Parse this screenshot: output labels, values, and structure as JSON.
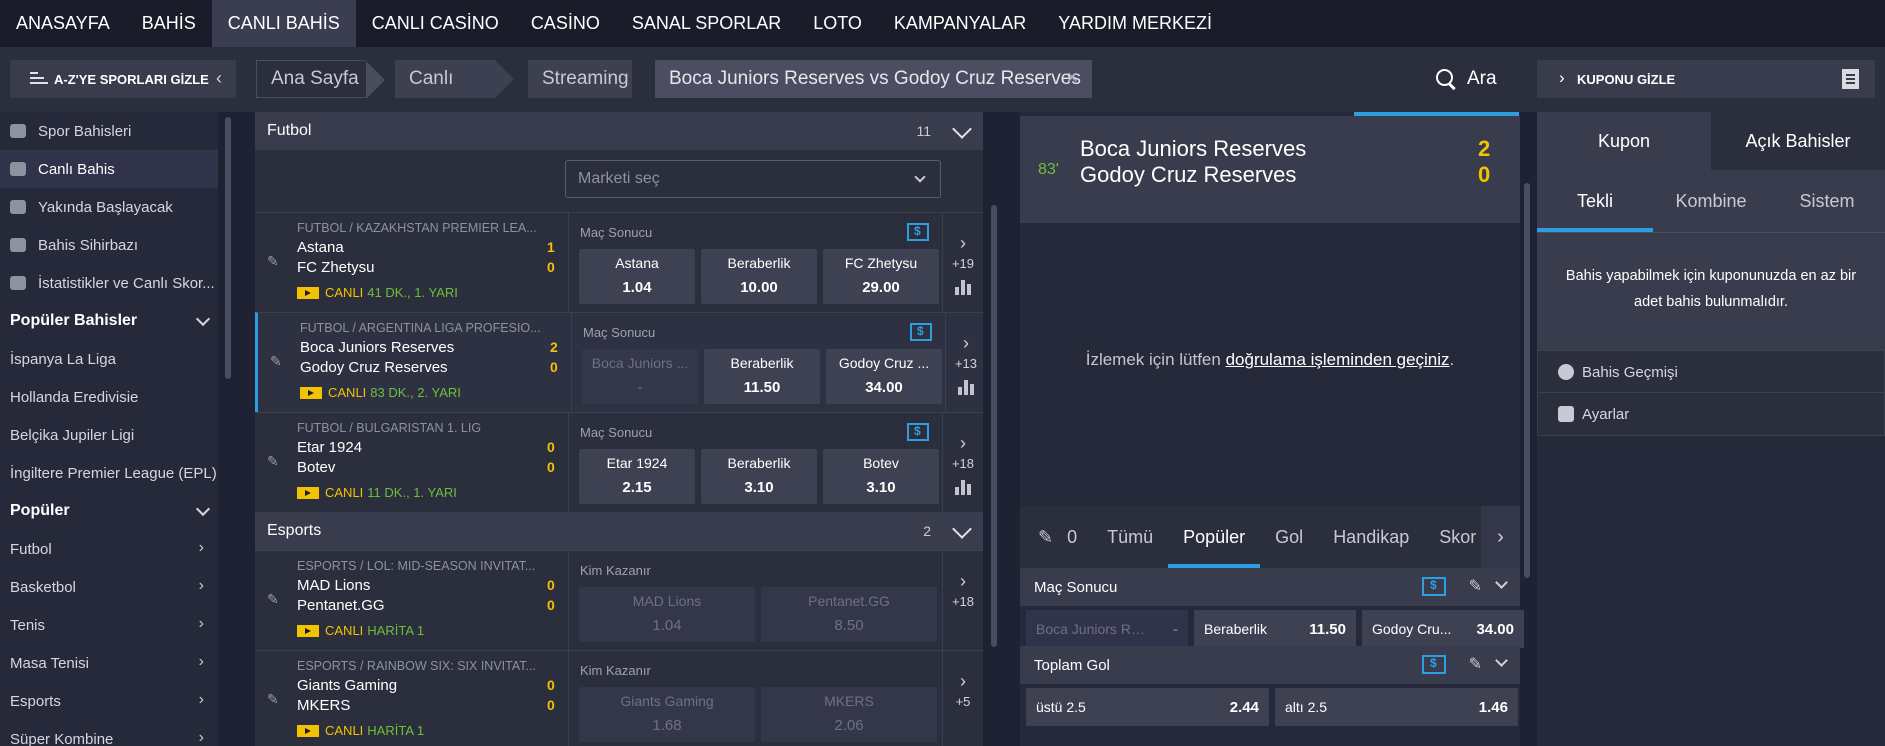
{
  "topnav": [
    "ANASAYFA",
    "BAHİS",
    "CANLI BAHİS",
    "CANLI CASİNO",
    "CASİNO",
    "SANAL SPORLAR",
    "LOTO",
    "KAMPANYALAR",
    "YARDIM MERKEZİ"
  ],
  "breadcrumbs": {
    "hide_sports": "A-Z'YE SPORLARI GİZLE",
    "home": "Ana Sayfa",
    "live": "Canlı",
    "streaming": "Streaming",
    "match": "Boca Juniors Reserves vs Godoy Cruz Reserves",
    "search": "Ara",
    "hide_coupon": "KUPONU GİZLE"
  },
  "sidebar": [
    {
      "label": "Spor Bahisleri",
      "type": "icon"
    },
    {
      "label": "Canlı Bahis",
      "type": "icon",
      "active": true
    },
    {
      "label": "Yakında Başlayacak",
      "type": "icon"
    },
    {
      "label": "Bahis Sihirbazı",
      "type": "icon"
    },
    {
      "label": "İstatistikler ve Canlı Skor...",
      "type": "icon"
    },
    {
      "label": "Popüler Bahisler",
      "type": "head"
    },
    {
      "label": "İspanya La Liga",
      "type": "plain"
    },
    {
      "label": "Hollanda Eredivisie",
      "type": "plain"
    },
    {
      "label": "Belçika Jupiler Ligi",
      "type": "plain"
    },
    {
      "label": "İngiltere Premier League (EPL)",
      "type": "plain"
    },
    {
      "label": "Popüler",
      "type": "head"
    },
    {
      "label": "Futbol",
      "type": "chev"
    },
    {
      "label": "Basketbol",
      "type": "chev"
    },
    {
      "label": "Tenis",
      "type": "chev"
    },
    {
      "label": "Masa Tenisi",
      "type": "chev"
    },
    {
      "label": "Esports",
      "type": "chev"
    },
    {
      "label": "Süper Kombine",
      "type": "chev"
    }
  ],
  "events": {
    "football_header": {
      "title": "Futbol",
      "count": "11"
    },
    "market_placeholder": "Marketi seç",
    "football": [
      {
        "league": "FUTBOL / KAZAKHSTAN PREMIER LEA...",
        "home": "Astana",
        "away": "FC Zhetysu",
        "hs": "1",
        "as": "0",
        "live": "CANLI",
        "minute": "41 DK., 1. YARI",
        "market": "Maç Sonucu",
        "odds": [
          {
            "l": "Astana",
            "v": "1.04"
          },
          {
            "l": "Beraberlik",
            "v": "10.00"
          },
          {
            "l": "FC Zhetysu",
            "v": "29.00"
          }
        ],
        "more": "+19"
      },
      {
        "league": "FUTBOL / ARGENTINA LIGA PROFESIO...",
        "home": "Boca Juniors Reserves",
        "away": "Godoy Cruz Reserves",
        "hs": "2",
        "as": "0",
        "live": "CANLI",
        "minute": "83 DK., 2. YARI",
        "market": "Maç Sonucu",
        "odds": [
          {
            "l": "Boca Juniors ...",
            "v": "-",
            "disabled": true
          },
          {
            "l": "Beraberlik",
            "v": "11.50"
          },
          {
            "l": "Godoy Cruz ...",
            "v": "34.00"
          }
        ],
        "more": "+13"
      },
      {
        "league": "FUTBOL / BULGARISTAN 1. LIG",
        "home": "Etar 1924",
        "away": "Botev",
        "hs": "0",
        "as": "0",
        "live": "CANLI",
        "minute": "11 DK., 1. YARI",
        "market": "Maç Sonucu",
        "odds": [
          {
            "l": "Etar 1924",
            "v": "2.15"
          },
          {
            "l": "Beraberlik",
            "v": "3.10"
          },
          {
            "l": "Botev",
            "v": "3.10"
          }
        ],
        "more": "+18"
      }
    ],
    "esports_header": {
      "title": "Esports",
      "count": "2"
    },
    "esports": [
      {
        "league": "ESPORTS / LOL: MID-SEASON INVITAT...",
        "home": "MAD Lions",
        "away": "Pentanet.GG",
        "hs": "0",
        "as": "0",
        "live": "CANLI",
        "minute": "HARİTA 1",
        "market": "Kim Kazanır",
        "odds": [
          {
            "l": "MAD Lions",
            "v": "1.04",
            "disabled": true
          },
          {
            "l": "Pentanet.GG",
            "v": "8.50",
            "disabled": true
          }
        ],
        "more": "+18"
      },
      {
        "league": "ESPORTS / RAINBOW SIX: SIX INVITAT...",
        "home": "Giants Gaming",
        "away": "MKERS",
        "hs": "0",
        "as": "0",
        "live": "CANLI",
        "minute": "HARİTA 1",
        "market": "Kim Kazanır",
        "odds": [
          {
            "l": "Giants Gaming",
            "v": "1.68",
            "disabled": true
          },
          {
            "l": "MKERS",
            "v": "2.06",
            "disabled": true
          }
        ],
        "more": "+5"
      }
    ]
  },
  "match": {
    "minute": "83'",
    "home": "Boca Juniors Reserves",
    "away": "Godoy Cruz Reserves",
    "home_score": "2",
    "away_score": "0",
    "stream_prefix": "İzlemek için lütfen",
    "stream_link": "doğrulama işleminden geçiniz",
    "stream_suffix": ".",
    "pin_count": "0",
    "tabs": [
      "Tümü",
      "Popüler",
      "Gol",
      "Handikap",
      "Skor"
    ],
    "markets": [
      {
        "title": "Maç Sonucu",
        "odds": [
          {
            "l": "Boca Juniors Re...",
            "v": "-",
            "disabled": true
          },
          {
            "l": "Beraberlik",
            "v": "11.50"
          },
          {
            "l": "Godoy Cru...",
            "v": "34.00"
          }
        ]
      },
      {
        "title": "Toplam Gol",
        "odds": [
          {
            "l": "üstü 2.5",
            "v": "2.44"
          },
          {
            "l": "altı 2.5",
            "v": "1.46"
          }
        ]
      }
    ]
  },
  "coupon": {
    "tabs": [
      "Kupon",
      "Açık Bahisler"
    ],
    "subtabs": [
      "Tekli",
      "Kombine",
      "Sistem"
    ],
    "empty": "Bahis yapabilmek için kuponunuzda en az bir adet bahis bulunmalıdır.",
    "history": "Bahis Geçmişi",
    "settings": "Ayarlar"
  },
  "colors": {
    "accent": "#2f9ee0",
    "score": "#f2c300",
    "live_minute": "#6fbf3a"
  }
}
